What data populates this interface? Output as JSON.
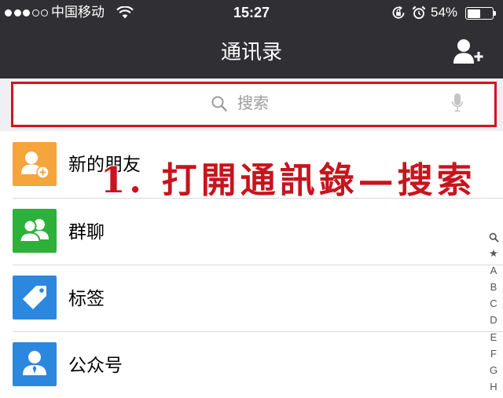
{
  "status_bar": {
    "signal_strength": 3,
    "signal_max": 5,
    "carrier": "中国移动",
    "time": "15:27",
    "battery": "54%"
  },
  "nav": {
    "title": "通讯录",
    "right_icon": "add-contact-icon"
  },
  "search": {
    "placeholder": "搜索",
    "left_icon": "search-icon",
    "right_icon": "microphone-icon"
  },
  "contacts": {
    "items": [
      {
        "label": "新的朋友",
        "icon": "new-friends-icon",
        "color": "#f6a43c"
      },
      {
        "label": "群聊",
        "icon": "group-chat-icon",
        "color": "#2eb13a"
      },
      {
        "label": "标签",
        "icon": "tag-icon",
        "color": "#2c87de"
      },
      {
        "label": "公众号",
        "icon": "official-account-icon",
        "color": "#2c87de"
      }
    ]
  },
  "index": {
    "top_icon": "search-icon",
    "letters": [
      "★",
      "A",
      "B",
      "C",
      "D",
      "E",
      "F",
      "G",
      "H"
    ]
  },
  "annotation": {
    "text": "1. 打開通訊錄—搜索",
    "color": "#c8141e",
    "highlight_color": "#d3141f"
  },
  "colors": {
    "bar": "#303034",
    "search_bg": "#efeff4"
  }
}
